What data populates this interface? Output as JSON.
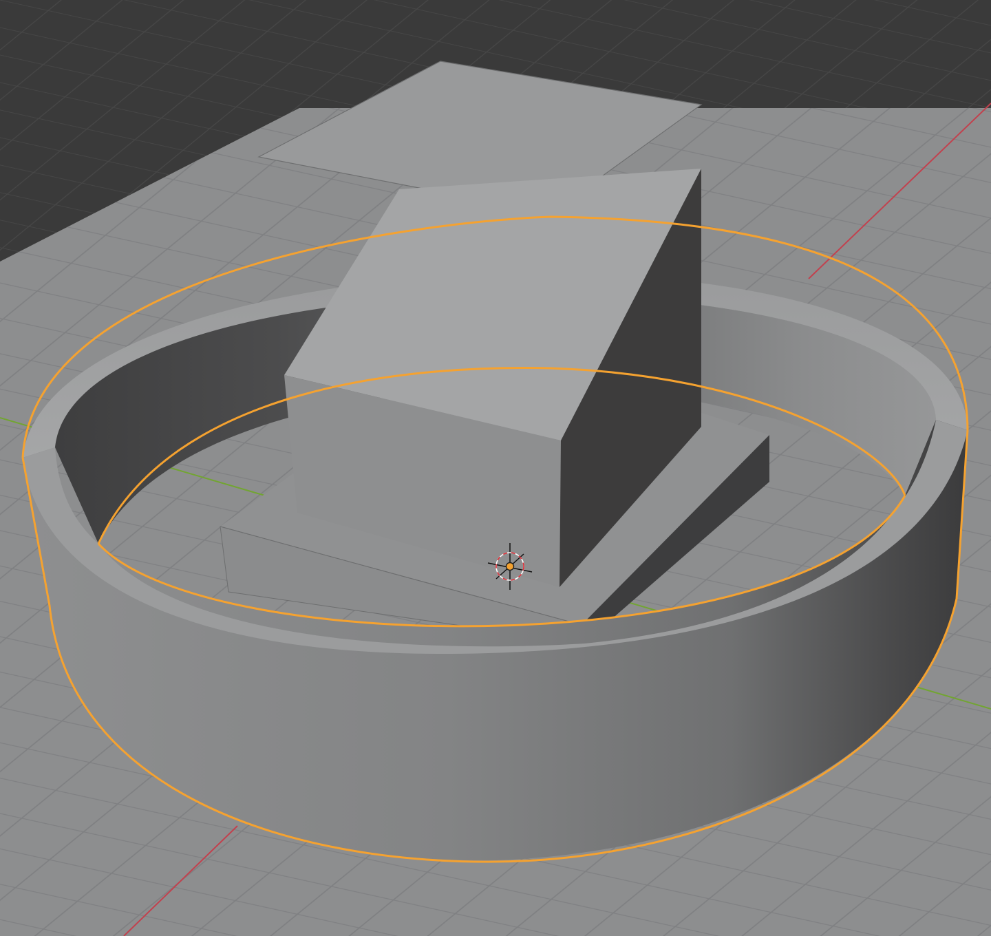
{
  "app": {
    "context": "3D viewport"
  },
  "viewport": {
    "shading": "solid",
    "background_color": "#3a3a3a",
    "floor_color": "#8d8e8f",
    "grid_line_color": "#7d7e80",
    "dark_grid_line_color": "#444444",
    "x_axis_color": "#c2414e",
    "y_axis_color": "#72a531",
    "selection_outline_color": "#f5a230",
    "cursor_ring_color": "#e0313a"
  },
  "scene": {
    "objects": [
      {
        "name": "plane",
        "selected": false
      },
      {
        "name": "base-slab",
        "selected": false
      },
      {
        "name": "cube",
        "selected": false
      },
      {
        "name": "ring",
        "selected": true
      }
    ],
    "origin_dot_color": "#f5a230",
    "cursor": "3d-cursor"
  }
}
